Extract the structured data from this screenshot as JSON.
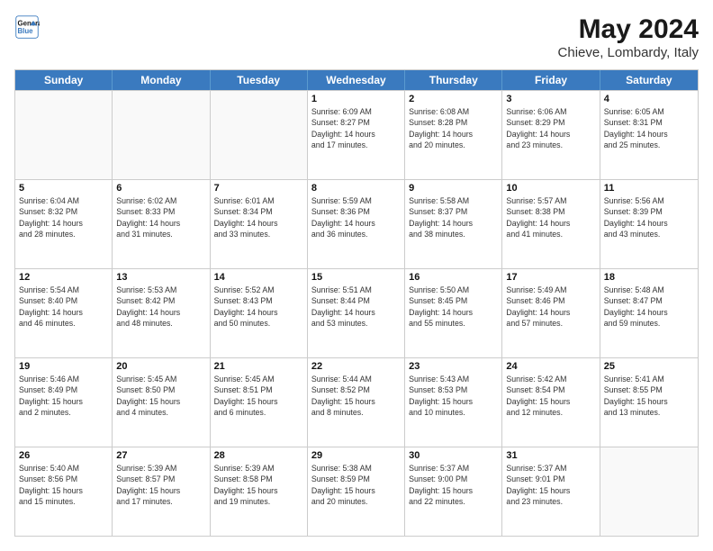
{
  "header": {
    "logo_line1": "General",
    "logo_line2": "Blue",
    "main_title": "May 2024",
    "subtitle": "Chieve, Lombardy, Italy"
  },
  "days": [
    "Sunday",
    "Monday",
    "Tuesday",
    "Wednesday",
    "Thursday",
    "Friday",
    "Saturday"
  ],
  "weeks": [
    [
      {
        "day": "",
        "empty": true,
        "lines": []
      },
      {
        "day": "",
        "empty": true,
        "lines": []
      },
      {
        "day": "",
        "empty": true,
        "lines": []
      },
      {
        "day": "1",
        "empty": false,
        "lines": [
          "Sunrise: 6:09 AM",
          "Sunset: 8:27 PM",
          "Daylight: 14 hours",
          "and 17 minutes."
        ]
      },
      {
        "day": "2",
        "empty": false,
        "lines": [
          "Sunrise: 6:08 AM",
          "Sunset: 8:28 PM",
          "Daylight: 14 hours",
          "and 20 minutes."
        ]
      },
      {
        "day": "3",
        "empty": false,
        "lines": [
          "Sunrise: 6:06 AM",
          "Sunset: 8:29 PM",
          "Daylight: 14 hours",
          "and 23 minutes."
        ]
      },
      {
        "day": "4",
        "empty": false,
        "lines": [
          "Sunrise: 6:05 AM",
          "Sunset: 8:31 PM",
          "Daylight: 14 hours",
          "and 25 minutes."
        ]
      }
    ],
    [
      {
        "day": "5",
        "empty": false,
        "lines": [
          "Sunrise: 6:04 AM",
          "Sunset: 8:32 PM",
          "Daylight: 14 hours",
          "and 28 minutes."
        ]
      },
      {
        "day": "6",
        "empty": false,
        "lines": [
          "Sunrise: 6:02 AM",
          "Sunset: 8:33 PM",
          "Daylight: 14 hours",
          "and 31 minutes."
        ]
      },
      {
        "day": "7",
        "empty": false,
        "lines": [
          "Sunrise: 6:01 AM",
          "Sunset: 8:34 PM",
          "Daylight: 14 hours",
          "and 33 minutes."
        ]
      },
      {
        "day": "8",
        "empty": false,
        "lines": [
          "Sunrise: 5:59 AM",
          "Sunset: 8:36 PM",
          "Daylight: 14 hours",
          "and 36 minutes."
        ]
      },
      {
        "day": "9",
        "empty": false,
        "lines": [
          "Sunrise: 5:58 AM",
          "Sunset: 8:37 PM",
          "Daylight: 14 hours",
          "and 38 minutes."
        ]
      },
      {
        "day": "10",
        "empty": false,
        "lines": [
          "Sunrise: 5:57 AM",
          "Sunset: 8:38 PM",
          "Daylight: 14 hours",
          "and 41 minutes."
        ]
      },
      {
        "day": "11",
        "empty": false,
        "lines": [
          "Sunrise: 5:56 AM",
          "Sunset: 8:39 PM",
          "Daylight: 14 hours",
          "and 43 minutes."
        ]
      }
    ],
    [
      {
        "day": "12",
        "empty": false,
        "lines": [
          "Sunrise: 5:54 AM",
          "Sunset: 8:40 PM",
          "Daylight: 14 hours",
          "and 46 minutes."
        ]
      },
      {
        "day": "13",
        "empty": false,
        "lines": [
          "Sunrise: 5:53 AM",
          "Sunset: 8:42 PM",
          "Daylight: 14 hours",
          "and 48 minutes."
        ]
      },
      {
        "day": "14",
        "empty": false,
        "lines": [
          "Sunrise: 5:52 AM",
          "Sunset: 8:43 PM",
          "Daylight: 14 hours",
          "and 50 minutes."
        ]
      },
      {
        "day": "15",
        "empty": false,
        "lines": [
          "Sunrise: 5:51 AM",
          "Sunset: 8:44 PM",
          "Daylight: 14 hours",
          "and 53 minutes."
        ]
      },
      {
        "day": "16",
        "empty": false,
        "lines": [
          "Sunrise: 5:50 AM",
          "Sunset: 8:45 PM",
          "Daylight: 14 hours",
          "and 55 minutes."
        ]
      },
      {
        "day": "17",
        "empty": false,
        "lines": [
          "Sunrise: 5:49 AM",
          "Sunset: 8:46 PM",
          "Daylight: 14 hours",
          "and 57 minutes."
        ]
      },
      {
        "day": "18",
        "empty": false,
        "lines": [
          "Sunrise: 5:48 AM",
          "Sunset: 8:47 PM",
          "Daylight: 14 hours",
          "and 59 minutes."
        ]
      }
    ],
    [
      {
        "day": "19",
        "empty": false,
        "lines": [
          "Sunrise: 5:46 AM",
          "Sunset: 8:49 PM",
          "Daylight: 15 hours",
          "and 2 minutes."
        ]
      },
      {
        "day": "20",
        "empty": false,
        "lines": [
          "Sunrise: 5:45 AM",
          "Sunset: 8:50 PM",
          "Daylight: 15 hours",
          "and 4 minutes."
        ]
      },
      {
        "day": "21",
        "empty": false,
        "lines": [
          "Sunrise: 5:45 AM",
          "Sunset: 8:51 PM",
          "Daylight: 15 hours",
          "and 6 minutes."
        ]
      },
      {
        "day": "22",
        "empty": false,
        "lines": [
          "Sunrise: 5:44 AM",
          "Sunset: 8:52 PM",
          "Daylight: 15 hours",
          "and 8 minutes."
        ]
      },
      {
        "day": "23",
        "empty": false,
        "lines": [
          "Sunrise: 5:43 AM",
          "Sunset: 8:53 PM",
          "Daylight: 15 hours",
          "and 10 minutes."
        ]
      },
      {
        "day": "24",
        "empty": false,
        "lines": [
          "Sunrise: 5:42 AM",
          "Sunset: 8:54 PM",
          "Daylight: 15 hours",
          "and 12 minutes."
        ]
      },
      {
        "day": "25",
        "empty": false,
        "lines": [
          "Sunrise: 5:41 AM",
          "Sunset: 8:55 PM",
          "Daylight: 15 hours",
          "and 13 minutes."
        ]
      }
    ],
    [
      {
        "day": "26",
        "empty": false,
        "lines": [
          "Sunrise: 5:40 AM",
          "Sunset: 8:56 PM",
          "Daylight: 15 hours",
          "and 15 minutes."
        ]
      },
      {
        "day": "27",
        "empty": false,
        "lines": [
          "Sunrise: 5:39 AM",
          "Sunset: 8:57 PM",
          "Daylight: 15 hours",
          "and 17 minutes."
        ]
      },
      {
        "day": "28",
        "empty": false,
        "lines": [
          "Sunrise: 5:39 AM",
          "Sunset: 8:58 PM",
          "Daylight: 15 hours",
          "and 19 minutes."
        ]
      },
      {
        "day": "29",
        "empty": false,
        "lines": [
          "Sunrise: 5:38 AM",
          "Sunset: 8:59 PM",
          "Daylight: 15 hours",
          "and 20 minutes."
        ]
      },
      {
        "day": "30",
        "empty": false,
        "lines": [
          "Sunrise: 5:37 AM",
          "Sunset: 9:00 PM",
          "Daylight: 15 hours",
          "and 22 minutes."
        ]
      },
      {
        "day": "31",
        "empty": false,
        "lines": [
          "Sunrise: 5:37 AM",
          "Sunset: 9:01 PM",
          "Daylight: 15 hours",
          "and 23 minutes."
        ]
      },
      {
        "day": "",
        "empty": true,
        "lines": []
      }
    ]
  ]
}
